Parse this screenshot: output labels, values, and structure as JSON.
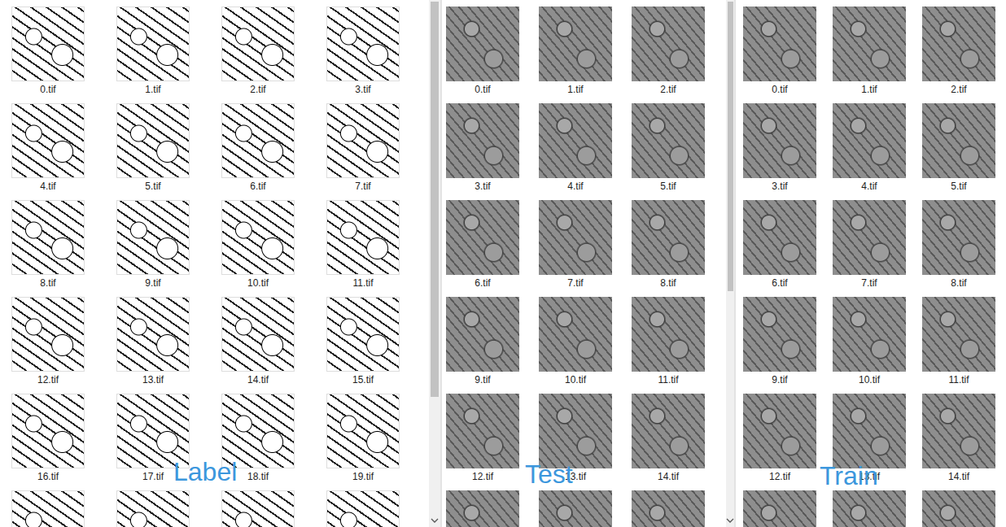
{
  "panes": [
    {
      "overlay_label": "Label",
      "kind": "label",
      "columns": 4,
      "items": [
        "0.tif",
        "1.tif",
        "2.tif",
        "3.tif",
        "4.tif",
        "5.tif",
        "6.tif",
        "7.tif",
        "8.tif",
        "9.tif",
        "10.tif",
        "11.tif",
        "12.tif",
        "13.tif",
        "14.tif",
        "15.tif",
        "16.tif",
        "17.tif",
        "18.tif",
        "19.tif"
      ],
      "cut_off_thumbnails": 4,
      "scrollbar": {
        "level": 0.75
      }
    },
    {
      "overlay_label": "Test",
      "kind": "image",
      "columns": 3,
      "items": [
        "0.tif",
        "1.tif",
        "2.tif",
        "3.tif",
        "4.tif",
        "5.tif",
        "6.tif",
        "7.tif",
        "8.tif",
        "9.tif",
        "10.tif",
        "11.tif",
        "12.tif",
        "13.tif",
        "14.tif"
      ],
      "cut_off_thumbnails": 3,
      "scrollbar": {
        "level": 0.55
      }
    },
    {
      "overlay_label": "Train",
      "kind": "image",
      "columns": 3,
      "items": [
        "0.tif",
        "1.tif",
        "2.tif",
        "3.tif",
        "4.tif",
        "5.tif",
        "6.tif",
        "7.tif",
        "8.tif",
        "9.tif",
        "10.tif",
        "11.tif",
        "12.tif",
        "13.tif",
        "14.tif"
      ],
      "cut_off_thumbnails": 3,
      "scrollbar": null
    }
  ]
}
